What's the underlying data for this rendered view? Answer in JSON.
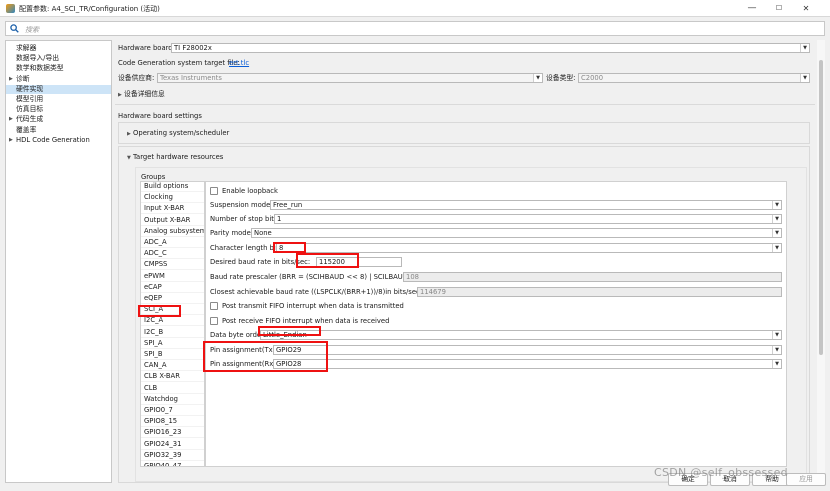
{
  "window": {
    "title": "配置参数: A4_SCI_TR/Configuration (活动)",
    "minimize": "—",
    "maximize": "☐",
    "close": "✕",
    "icon": "matlab-app-icon"
  },
  "search": {
    "placeholder": "搜索"
  },
  "tree": {
    "items": [
      {
        "label": "求解器",
        "arrow": ""
      },
      {
        "label": "数据导入/导出",
        "arrow": ""
      },
      {
        "label": "数学和数据类型",
        "arrow": ""
      },
      {
        "label": "诊断",
        "arrow": "▶"
      },
      {
        "label": "硬件实现",
        "arrow": "",
        "selected": true
      },
      {
        "label": "模型引用",
        "arrow": ""
      },
      {
        "label": "仿真目标",
        "arrow": ""
      },
      {
        "label": "代码生成",
        "arrow": "▶"
      },
      {
        "label": "覆盖率",
        "arrow": ""
      },
      {
        "label": "HDL Code Generation",
        "arrow": "▶"
      }
    ]
  },
  "hw": {
    "board_label": "Hardware board:",
    "board_value": "TI F28002x",
    "cg_label": "Code Generation system target file:",
    "cg_link": "ert.tlc",
    "vendor_label": "设备供应商:",
    "vendor_value": "Texas Instruments",
    "type_label": "设备类型:",
    "type_value": "C2000",
    "details_label": "设备详细信息",
    "settings_label": "Hardware board settings",
    "os_label": "Operating system/scheduler",
    "thr_label": "Target hardware resources",
    "groups_label": "Groups"
  },
  "groups": [
    "Build options",
    "Clocking",
    "Input X-BAR",
    "Output X-BAR",
    "Analog subsystem",
    "ADC_A",
    "ADC_C",
    "CMPSS",
    "ePWM",
    "eCAP",
    "eQEP",
    "SCI_A",
    "I2C_A",
    "I2C_B",
    "SPI_A",
    "SPI_B",
    "CAN_A",
    "CLB X-BAR",
    "CLB",
    "Watchdog",
    "GPIO0_7",
    "GPIO8_15",
    "GPIO16_23",
    "GPIO24_31",
    "GPIO32_39",
    "GPIO40_47"
  ],
  "params": {
    "loopback": "Enable loopback",
    "susp_label": "Suspension mode:",
    "susp_value": "Free_run",
    "stop_label": "Number of stop bits:",
    "stop_value": "1",
    "parity_label": "Parity mode:",
    "parity_value": "None",
    "char_label": "Character length bits:",
    "char_value": "8",
    "baud_label": "Desired baud rate in bits/sec:",
    "baud_value": "115200",
    "presc_label": "Baud rate prescaler (BRR = (SCIHBAUD << 8) | SCILBAUD)):",
    "presc_value": "108",
    "closest_label": "Closest achievable baud rate ((LSPCLK/(BRR+1))/8)in bits/sec:",
    "closest_value": "114679",
    "tx_fifo": "Post transmit FIFO interrupt when data is transmitted",
    "rx_fifo": "Post receive FIFO interrupt when data is received",
    "order_label": "Data byte order:",
    "order_value": "Little_Endian",
    "pintx_label": "Pin assignment(Tx):",
    "pintx_value": "GPIO29",
    "pinrx_label": "Pin assignment(Rx):",
    "pinrx_value": "GPIO28"
  },
  "buttons": {
    "ok": "确定",
    "cancel": "取消",
    "help": "帮助",
    "apply": "应用"
  },
  "watermark": "CSDN @self_obssessed",
  "colors": {
    "highlight": "#e11111",
    "selection": "#cde4f7",
    "link": "#0b5ed7"
  }
}
